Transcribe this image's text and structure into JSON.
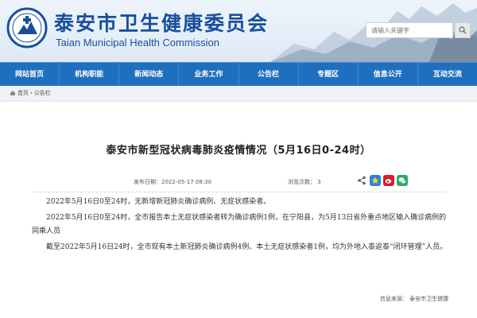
{
  "header": {
    "title": "泰安市卫生健康委员会",
    "subtitle": "Taian Municipal Health Commission",
    "search_placeholder": "请输入关键字",
    "brand_color": "#1a4f9c"
  },
  "nav": {
    "color": "#1f6fbf",
    "items": [
      "网站首页",
      "机构职能",
      "新闻动态",
      "业务工作",
      "公告栏",
      "专题区",
      "信息公开",
      "互动交流"
    ]
  },
  "breadcrumb": {
    "home": "首页",
    "separator": "›",
    "current": "公告栏"
  },
  "article": {
    "title": "泰安市新型冠状病毒肺炎疫情情况（5月16日0-24时）",
    "publish_date": "发布日期：2022-05-17 08:30",
    "views": "浏览次数：  3",
    "paragraphs": [
      "2022年5月16日0至24时，无新增新冠肺炎确诊病例、无症状感染者。",
      "2022年5月16日0至24时，全市报告本土无症状感染者转为确诊病例1例，在宁阳县，为5月13日省外重点地区输入确诊病例的同乘人员",
      "截至2022年5月16日24时，全市现有本土新冠肺炎确诊病例4例、本土无症状感染者1例，均为外地入泰返泰“闭环管理”人员。"
    ],
    "source": "信息来源：  泰安市卫生健康"
  },
  "share": {
    "icons": [
      "share-icon",
      "qzone-icon",
      "weibo-icon",
      "wechat-icon"
    ]
  }
}
